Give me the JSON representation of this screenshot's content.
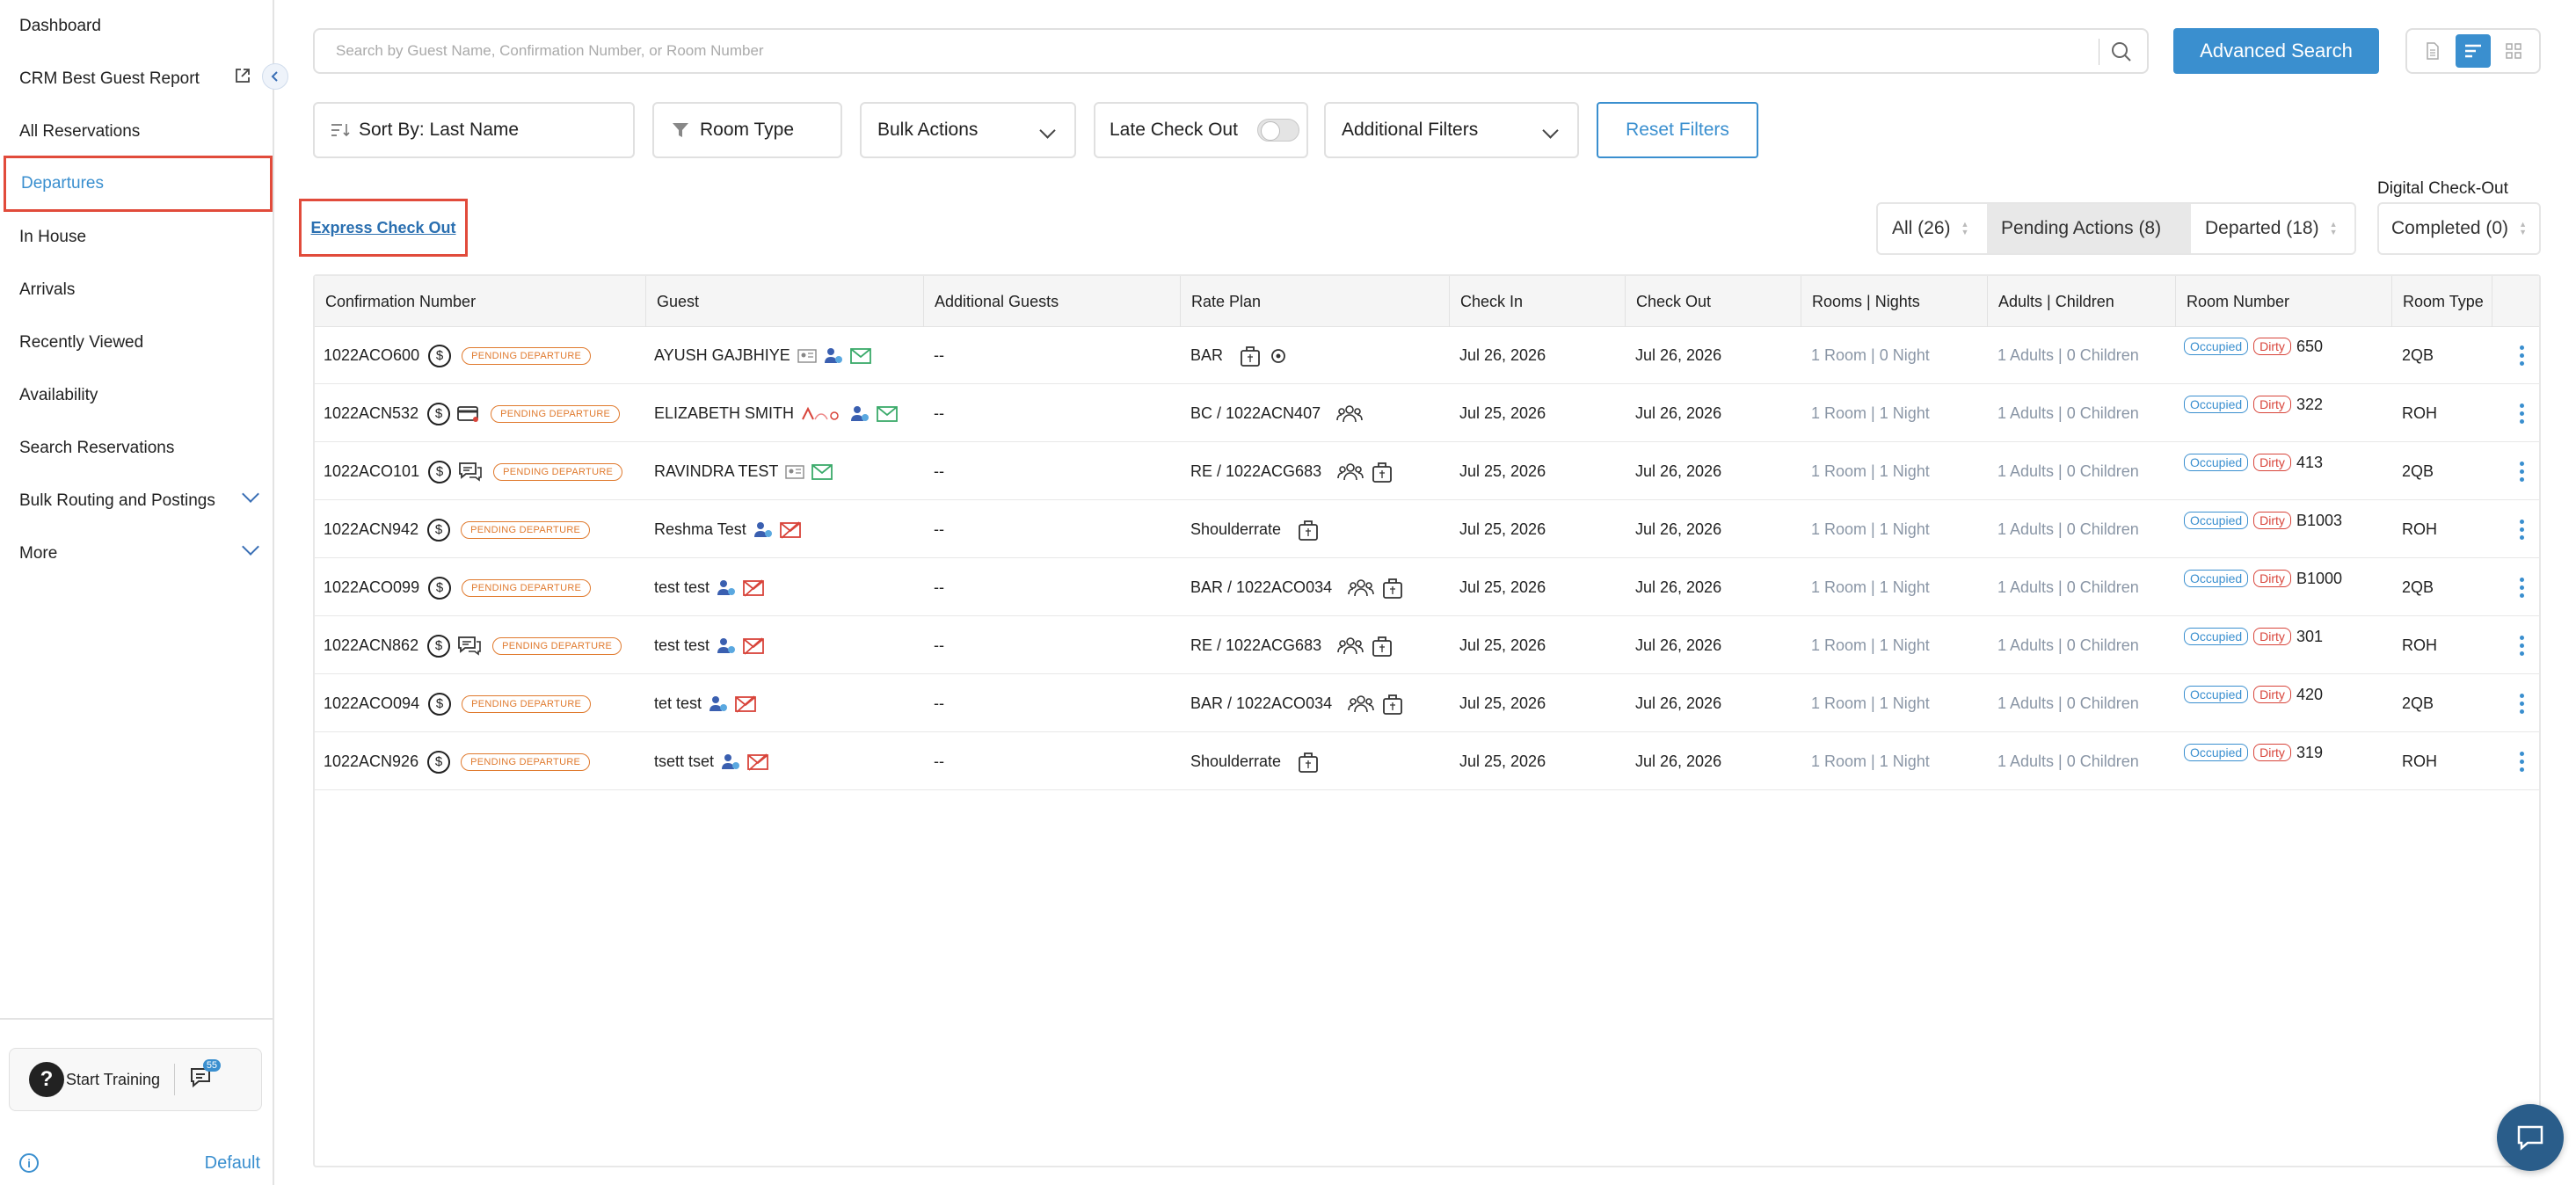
{
  "sidebar": {
    "items": [
      {
        "label": "Dashboard"
      },
      {
        "label": "CRM Best Guest Report"
      },
      {
        "label": "All Reservations"
      },
      {
        "label": "Departures"
      },
      {
        "label": "In House"
      },
      {
        "label": "Arrivals"
      },
      {
        "label": "Recently Viewed"
      },
      {
        "label": "Availability"
      },
      {
        "label": "Search Reservations"
      },
      {
        "label": "Bulk Routing and Postings"
      },
      {
        "label": "More"
      }
    ],
    "active": "Departures",
    "training_label": "Start Training",
    "chat_badge": "55",
    "default_label": "Default"
  },
  "search": {
    "placeholder": "Search by Guest Name, Confirmation Number, or Room Number",
    "advanced_label": "Advanced Search"
  },
  "filters": {
    "sort_by": "Sort By: Last Name",
    "room_type": "Room Type",
    "bulk_actions": "Bulk Actions",
    "late_checkout": "Late Check Out",
    "late_checkout_on": false,
    "additional_filters": "Additional Filters",
    "reset": "Reset Filters"
  },
  "express_checkout": "Express Check Out",
  "status_tabs": {
    "all": "All (26)",
    "pending": "Pending Actions (8)",
    "departed": "Departed (18)",
    "active": "Pending Actions (8)"
  },
  "digital_checkout": {
    "label": "Digital Check-Out",
    "completed": "Completed (0)"
  },
  "table": {
    "headers": [
      "Confirmation Number",
      "Guest",
      "Additional Guests",
      "Rate Plan",
      "Check In",
      "Check Out",
      "Rooms | Nights",
      "Adults | Children",
      "Room Number",
      "Room Type"
    ],
    "pending_badge": "PENDING DEPARTURE",
    "occupied_label": "Occupied",
    "dirty_label": "Dirty",
    "rows": [
      {
        "conf": "1022ACO600",
        "guest": "AYUSH GAJBHIYE",
        "addl": "--",
        "rate": "BAR",
        "checkin": "Jul 26, 2026",
        "checkout": "Jul 26, 2026",
        "rooms": "1 Room | 0 Night",
        "adults": "1 Adults | 0 Children",
        "room": "650",
        "type": "2QB"
      },
      {
        "conf": "1022ACN532",
        "guest": "ELIZABETH SMITH",
        "addl": "--",
        "rate": "BC / 1022ACN407",
        "checkin": "Jul 25, 2026",
        "checkout": "Jul 26, 2026",
        "rooms": "1 Room | 1 Night",
        "adults": "1 Adults | 0 Children",
        "room": "322",
        "type": "ROH"
      },
      {
        "conf": "1022ACO101",
        "guest": "RAVINDRA TEST",
        "addl": "--",
        "rate": "RE / 1022ACG683",
        "checkin": "Jul 25, 2026",
        "checkout": "Jul 26, 2026",
        "rooms": "1 Room | 1 Night",
        "adults": "1 Adults | 0 Children",
        "room": "413",
        "type": "2QB"
      },
      {
        "conf": "1022ACN942",
        "guest": "Reshma Test",
        "addl": "--",
        "rate": "Shoulderrate",
        "checkin": "Jul 25, 2026",
        "checkout": "Jul 26, 2026",
        "rooms": "1 Room | 1 Night",
        "adults": "1 Adults | 0 Children",
        "room": "B1003",
        "type": "ROH"
      },
      {
        "conf": "1022ACO099",
        "guest": "test test",
        "addl": "--",
        "rate": "BAR / 1022ACO034",
        "checkin": "Jul 25, 2026",
        "checkout": "Jul 26, 2026",
        "rooms": "1 Room | 1 Night",
        "adults": "1 Adults | 0 Children",
        "room": "B1000",
        "type": "2QB"
      },
      {
        "conf": "1022ACN862",
        "guest": "test test",
        "addl": "--",
        "rate": "RE / 1022ACG683",
        "checkin": "Jul 25, 2026",
        "checkout": "Jul 26, 2026",
        "rooms": "1 Room | 1 Night",
        "adults": "1 Adults | 0 Children",
        "room": "301",
        "type": "ROH"
      },
      {
        "conf": "1022ACO094",
        "guest": "tet test",
        "addl": "--",
        "rate": "BAR / 1022ACO034",
        "checkin": "Jul 25, 2026",
        "checkout": "Jul 26, 2026",
        "rooms": "1 Room | 1 Night",
        "adults": "1 Adults | 0 Children",
        "room": "420",
        "type": "2QB"
      },
      {
        "conf": "1022ACN926",
        "guest": "tsett tset",
        "addl": "--",
        "rate": "Shoulderrate",
        "checkin": "Jul 25, 2026",
        "checkout": "Jul 26, 2026",
        "rooms": "1 Room | 1 Night",
        "adults": "1 Adults | 0 Children",
        "room": "319",
        "type": "ROH"
      }
    ]
  },
  "colors": {
    "accent": "#3a8fcf",
    "highlight": "#e14b3b",
    "pending": "#e07a2e",
    "dirty": "#d8443a"
  }
}
